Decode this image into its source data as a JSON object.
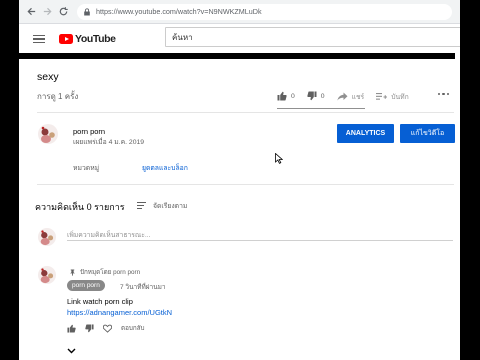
{
  "browser": {
    "url": "https://www.youtube.com/watch?v=N9NWKZMLuDk"
  },
  "header": {
    "logo_text": "YouTube",
    "search_value": "ค้นหา"
  },
  "video": {
    "title": "sexy",
    "views": "การดู 1 ครั้ง",
    "likes": "0",
    "dislikes": "0",
    "share_label": "แชร์",
    "save_label": "บันทึก"
  },
  "channel": {
    "name": "porn porn",
    "published": "เผยแพร่เมื่อ 4 ม.ค. 2019",
    "analytics_button": "ANALYTICS",
    "edit_button": "แก้ไขวิดีโอ",
    "category_label": "หมวดหมู่",
    "category_value": "ยูดตลและบล็อก"
  },
  "comments": {
    "count_label": "ความคิดเห็น 0 รายการ",
    "sort_label": "จัดเรียงตาม",
    "add_placeholder": "เพิ่มความคิดเห็นสาธารณะ...",
    "pinned_label": "ปักหมุดโดย porn porn",
    "items": [
      {
        "author": "porn porn",
        "time": "7 วินาทีที่ผ่านมา",
        "text": "Link watch porn clip",
        "link": "https://adnangamer.com/UGtkN",
        "reply_label": "ตอบกลับ"
      }
    ]
  },
  "colors": {
    "brand_red": "#ff0000",
    "button_blue": "#065fd4",
    "link_blue": "#065fd4",
    "chip_gray": "#888888"
  }
}
